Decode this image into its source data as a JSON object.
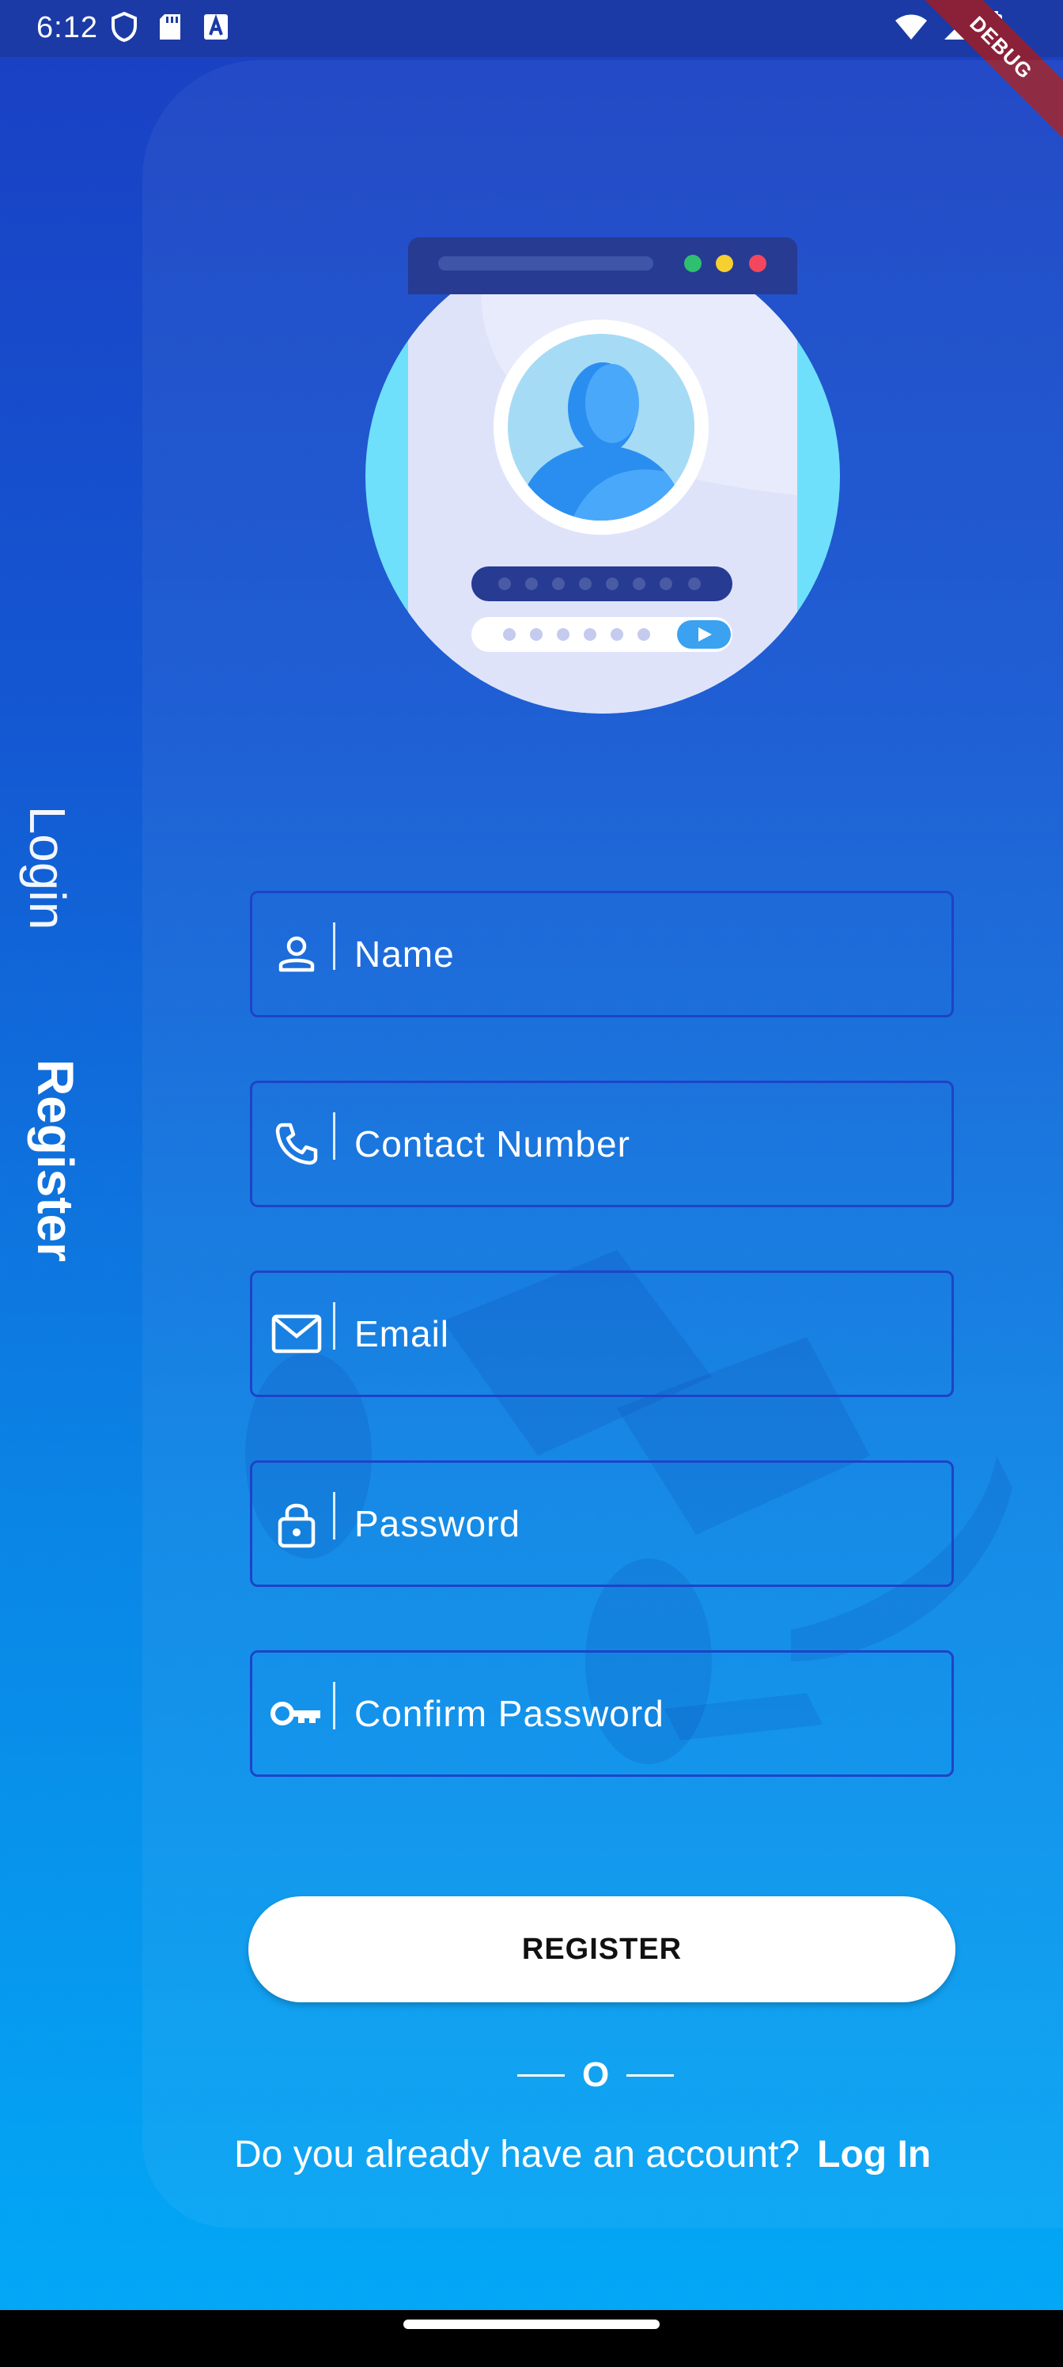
{
  "status_bar": {
    "time": "6:12",
    "left_icons": [
      "shield-icon",
      "sd-card-icon",
      "keyboard-icon"
    ],
    "right_icons": [
      "wifi-icon",
      "signal-icon",
      "battery-icon"
    ]
  },
  "debug_banner": "DEBUG",
  "side_nav": {
    "login": "Login",
    "register": "Register"
  },
  "form": {
    "fields": [
      {
        "placeholder": "Name",
        "icon": "person-icon"
      },
      {
        "placeholder": "Contact Number",
        "icon": "phone-icon"
      },
      {
        "placeholder": "Email",
        "icon": "mail-icon"
      },
      {
        "placeholder": "Password",
        "icon": "lock-icon"
      },
      {
        "placeholder": "Confirm Password",
        "icon": "key-icon"
      }
    ],
    "register_label": "REGISTER",
    "or_text": "O",
    "account_question": "Do you already have an account?",
    "login_link": "Log In"
  },
  "colors": {
    "background_top": "#1a3fc3",
    "background_bottom": "#02aaf7",
    "field_border": "#1e43c8",
    "button_bg": "#ffffff"
  }
}
